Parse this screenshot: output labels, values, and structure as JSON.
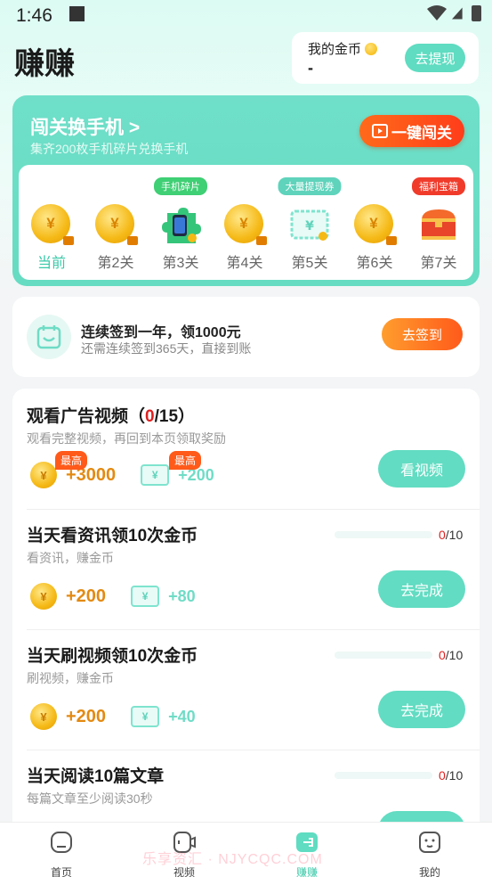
{
  "status_bar": {
    "time": "1:46"
  },
  "header": {
    "title": "赚赚"
  },
  "wallet": {
    "label": "我的金币",
    "value": "-",
    "withdraw_label": "去提现"
  },
  "challenge": {
    "title": "闯关换手机",
    "chevron": ">",
    "subtitle": "集齐200枚手机碎片兑换手机",
    "go_button": "一键闯关",
    "levels": [
      {
        "label": "当前",
        "icon": "coin-icon",
        "tag": ""
      },
      {
        "label": "第2关",
        "icon": "coin-icon",
        "tag": ""
      },
      {
        "label": "第3关",
        "icon": "phone-piece-icon",
        "tag": "手机碎片"
      },
      {
        "label": "第4关",
        "icon": "coin-icon",
        "tag": ""
      },
      {
        "label": "第5关",
        "icon": "ticket-icon",
        "tag": "大量提现券"
      },
      {
        "label": "第6关",
        "icon": "coin-icon",
        "tag": ""
      },
      {
        "label": "第7关",
        "icon": "treasure-chest-icon",
        "tag": "福利宝箱"
      }
    ],
    "colors": {
      "tag_green": "#3fcf74",
      "tag_teal": "#5fd3bb",
      "tag_red": "#f03b2b"
    }
  },
  "signin": {
    "title": "连续签到一年，领1000元",
    "subtitle": "还需连续签到365天，直接到账",
    "button": "去签到"
  },
  "tasks": [
    {
      "title_prefix": "观看广告视频（",
      "title_count": "0",
      "title_suffix": "/15）",
      "desc": "观看完整视频，再回到本页领取奖励",
      "coin_reward": "+3000",
      "ticket_reward": "+200",
      "badge": "最高",
      "button": "看视频"
    },
    {
      "title": "当天看资讯领10次金币",
      "desc": "看资讯，赚金币",
      "coin_reward": "+200",
      "ticket_reward": "+80",
      "progress_done": "0",
      "progress_total": "/10",
      "progress_value": 0,
      "button": "去完成"
    },
    {
      "title": "当天刷视频领10次金币",
      "desc": "刷视频，赚金币",
      "coin_reward": "+200",
      "ticket_reward": "+40",
      "progress_done": "0",
      "progress_total": "/10",
      "progress_value": 0,
      "button": "去完成"
    },
    {
      "title": "当天阅读10篇文章",
      "desc": "每篇文章至少阅读30秒",
      "progress_done": "0",
      "progress_total": "/10",
      "progress_value": 0
    }
  ],
  "ticket_symbol": "¥",
  "nav": [
    {
      "label": "首页",
      "icon": "home-icon"
    },
    {
      "label": "视频",
      "icon": "video-icon"
    },
    {
      "label": "赚赚",
      "icon": "earn-icon",
      "active": true
    },
    {
      "label": "我的",
      "icon": "profile-icon"
    }
  ],
  "watermark": "乐享资汇 · NJYCQC.COM",
  "colors": {
    "accent": "#5fdcc1",
    "orange": "#ff5a1a",
    "coin": "#f5b916"
  }
}
